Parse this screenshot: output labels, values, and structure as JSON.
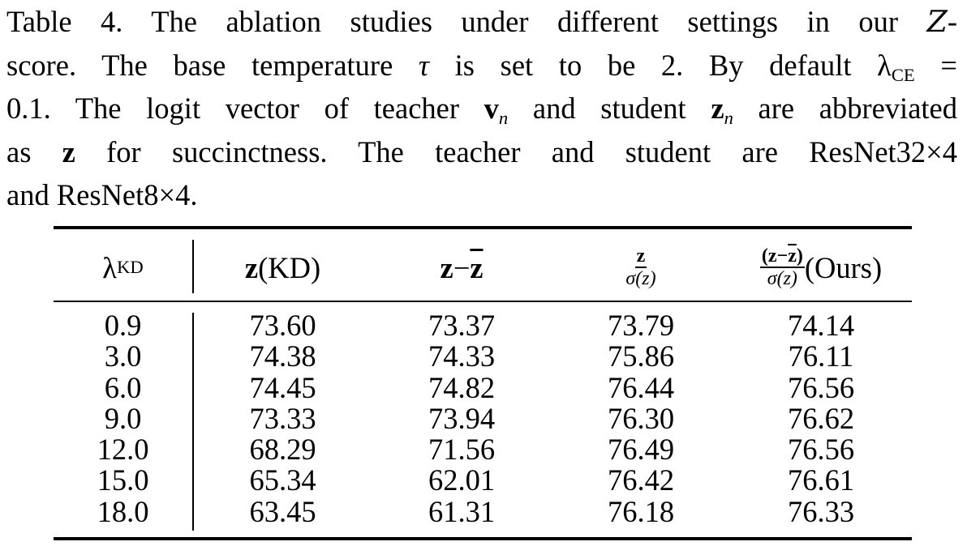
{
  "caption": {
    "line1_a": "Table 4.  The ablation studies under different settings in our ",
    "line1_z": "Z",
    "line1_b": "-",
    "line2_a": "score.  The base temperature ",
    "line2_tau": "τ",
    "line2_b": " is set to be 2.  By default ",
    "line2_lambda": "λ",
    "line2_sub": "CE",
    "line2_c": " =",
    "line3_a": "0.1. The logit vector of teacher ",
    "line3_v": "v",
    "line3_n1": "n",
    "line3_b": " and student ",
    "line3_z": "z",
    "line3_n2": "n",
    "line3_c": " are abbreviated",
    "line4_a": "as ",
    "line4_z": "z",
    "line4_b": " for succinctness.  The teacher and student are ResNet32×4",
    "line5": "and ResNet8×4."
  },
  "table": {
    "headers": {
      "lambda": "λ",
      "lambda_sub": "KD",
      "col1_z": "z",
      "col1_rest": " (KD)",
      "col2_z": "z",
      "col2_minus": " − ",
      "col2_zbar": "z",
      "col3_num": "z",
      "col3_den": "σ(z)",
      "col4_num": "(z−z)",
      "col4_den": "σ(z)",
      "col4_ours": " (Ours)"
    },
    "lambda_kd": [
      "0.9",
      "3.0",
      "6.0",
      "9.0",
      "12.0",
      "15.0",
      "18.0"
    ],
    "z_kd": [
      "73.60",
      "74.38",
      "74.45",
      "73.33",
      "68.29",
      "65.34",
      "63.45"
    ],
    "z_minus_mean": [
      "73.37",
      "74.33",
      "74.82",
      "73.94",
      "71.56",
      "62.01",
      "61.31"
    ],
    "z_over_std": [
      "73.79",
      "75.86",
      "76.44",
      "76.30",
      "76.49",
      "76.42",
      "76.18"
    ],
    "zscore_ours": [
      "74.14",
      "76.11",
      "76.56",
      "76.62",
      "76.56",
      "76.61",
      "76.33"
    ]
  }
}
